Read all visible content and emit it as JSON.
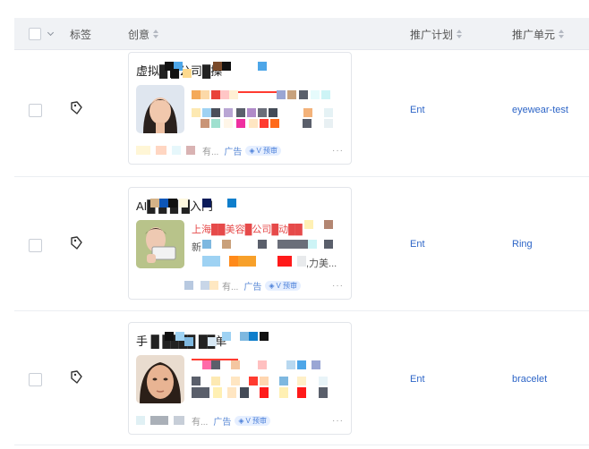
{
  "header": {
    "tag": "标签",
    "creative": "创意",
    "plan": "推广计划",
    "unit": "推广单元"
  },
  "rows": [
    {
      "title": "虚拟█ █公司█操",
      "footer_text": "有...",
      "ad_label": "广告",
      "verify_label": "V 预审",
      "more": "···",
      "plan": "Ent",
      "unit": "eyewear-test",
      "line1": "",
      "line2": "",
      "line3": "",
      "accent": "#ff3b30"
    },
    {
      "title": "AI█  █   █  █入门",
      "footer_text": "有...",
      "ad_label": "广告",
      "verify_label": "V 预审",
      "more": "···",
      "plan": "Ent",
      "unit": "Ring",
      "line1": "上海██美容█公司█动██",
      "line2": "新",
      "line3": ",力美...",
      "accent": "#ff3b30"
    },
    {
      "title": "手  █  ████  ██单",
      "footer_text": "有...",
      "ad_label": "广告",
      "verify_label": "V 预审",
      "more": "···",
      "plan": "Ent",
      "unit": "bracelet",
      "line1": "",
      "line2": "",
      "line3": "",
      "accent": "#ff3b30"
    }
  ],
  "icons": {
    "select_all": "checkbox-icon",
    "dropdown": "chevron-down-icon",
    "sort": "sort-icon",
    "tag": "tag-icon",
    "verify": "shield-check-icon"
  }
}
